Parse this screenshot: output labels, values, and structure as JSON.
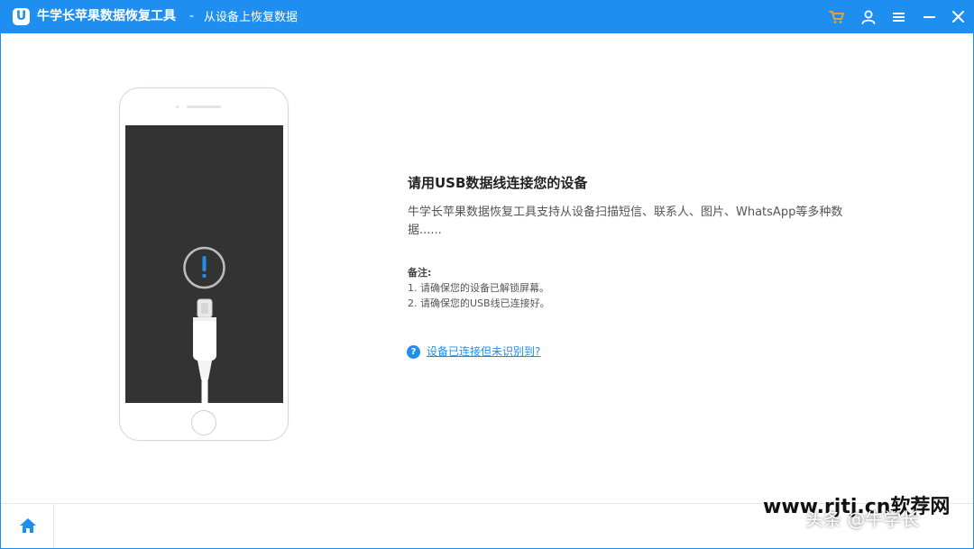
{
  "titlebar": {
    "logo_letter": "U",
    "app_title": "牛学长苹果数据恢复工具",
    "separator": "-",
    "sub_title": "从设备上恢复数据",
    "icons": [
      "cart-icon",
      "user-icon",
      "menu-icon",
      "minimize-icon",
      "close-icon"
    ]
  },
  "main": {
    "heading": "请用USB数据线连接您的设备",
    "description": "牛学长苹果数据恢复工具支持从设备扫描短信、联系人、图片、WhatsApp等多种数据......",
    "note_title": "备注:",
    "notes": [
      "1. 请确保您的设备已解锁屏幕。",
      "2. 请确保您的USB线已连接好。"
    ],
    "help_icon": "?",
    "help_link": "设备已连接但未识别到?"
  },
  "footer": {
    "home_icon": "home-icon"
  },
  "watermark": {
    "line1": "www.rjtj.cn软荐网",
    "line2": "头条 @牛学长"
  },
  "colors": {
    "accent": "#1e8ff0",
    "cart": "#f5a623",
    "screen": "#333333"
  }
}
